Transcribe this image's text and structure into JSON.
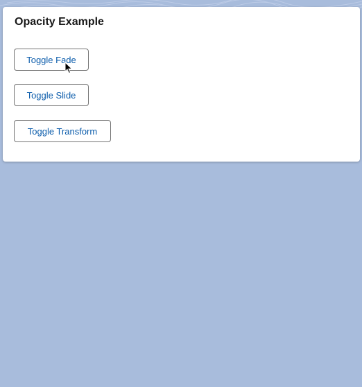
{
  "card": {
    "title": "Opacity Example"
  },
  "buttons": {
    "fade_label": "Toggle Fade",
    "slide_label": "Toggle Slide",
    "transform_label": "Toggle Transform"
  },
  "colors": {
    "background": "#a8bcdc",
    "card": "#ffffff",
    "button_text": "#0b5cab",
    "button_border": "#747474",
    "title_text": "#181818"
  },
  "icons": {
    "cursor": "mouse-pointer-icon"
  }
}
